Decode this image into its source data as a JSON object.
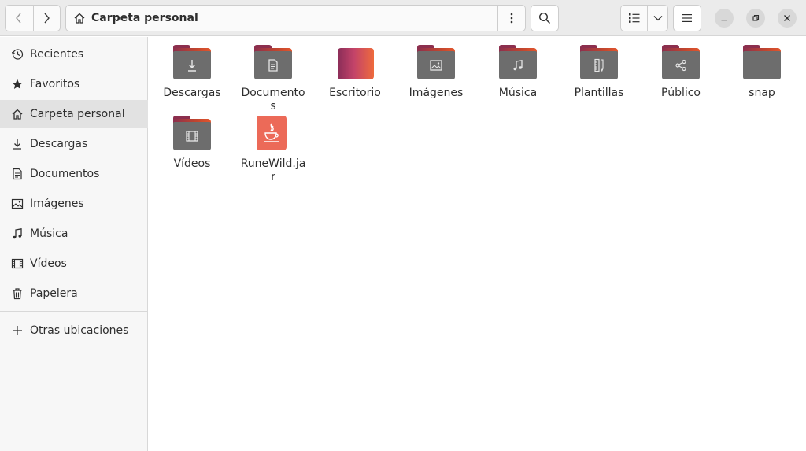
{
  "header": {
    "location_label": "Carpeta personal",
    "back_icon": "chevron-left-icon",
    "forward_icon": "chevron-right-icon",
    "home_icon": "home-icon",
    "menu_icon": "vertical-dots-icon",
    "search_icon": "search-icon",
    "view_icon": "list-view-icon",
    "view_dropdown_icon": "chevron-down-icon",
    "main_menu_icon": "hamburger-icon",
    "window_buttons": [
      "minimize-icon",
      "restore-icon",
      "close-icon"
    ]
  },
  "sidebar": {
    "items": [
      {
        "label": "Recientes",
        "icon": "clock-icon",
        "active": false
      },
      {
        "label": "Favoritos",
        "icon": "star-icon",
        "active": false
      },
      {
        "label": "Carpeta personal",
        "icon": "home-icon",
        "active": true
      },
      {
        "label": "Descargas",
        "icon": "download-icon",
        "active": false
      },
      {
        "label": "Documentos",
        "icon": "document-icon",
        "active": false
      },
      {
        "label": "Imágenes",
        "icon": "image-icon",
        "active": false
      },
      {
        "label": "Música",
        "icon": "music-icon",
        "active": false
      },
      {
        "label": "Vídeos",
        "icon": "film-icon",
        "active": false
      },
      {
        "label": "Papelera",
        "icon": "trash-icon",
        "active": false
      }
    ],
    "other_locations": {
      "label": "Otras ubicaciones",
      "icon": "plus-icon"
    }
  },
  "files": [
    {
      "name": "Descargas",
      "kind": "folder",
      "emblem": "download-icon"
    },
    {
      "name": "Documentos",
      "kind": "folder",
      "emblem": "document-icon"
    },
    {
      "name": "Escritorio",
      "kind": "desktop",
      "emblem": ""
    },
    {
      "name": "Imágenes",
      "kind": "folder",
      "emblem": "image-icon"
    },
    {
      "name": "Música",
      "kind": "folder",
      "emblem": "music-icon"
    },
    {
      "name": "Plantillas",
      "kind": "folder",
      "emblem": "template-icon"
    },
    {
      "name": "Público",
      "kind": "folder",
      "emblem": "share-icon"
    },
    {
      "name": "snap",
      "kind": "folder",
      "emblem": ""
    },
    {
      "name": "Vídeos",
      "kind": "folder",
      "emblem": "film-icon"
    },
    {
      "name": "RuneWild.jar",
      "kind": "jar",
      "emblem": "java-icon"
    }
  ],
  "colors": {
    "folder_body": "#6d6d6d",
    "folder_accent": "#c0452f",
    "jar_file": "#ec6a58",
    "sidebar_active": "#e2e2e2"
  }
}
